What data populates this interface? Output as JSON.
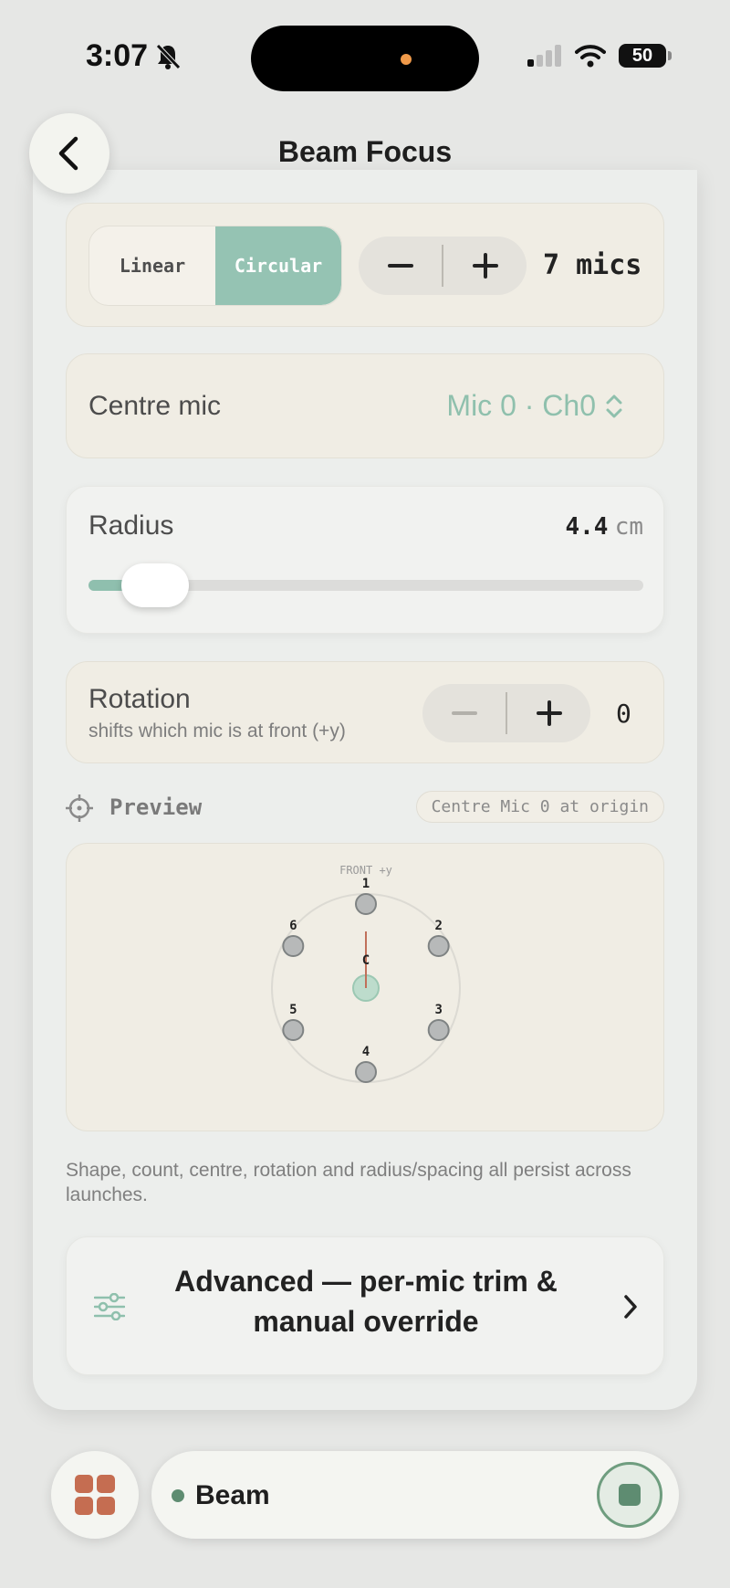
{
  "status": {
    "time": "3:07",
    "battery": "50"
  },
  "header": {
    "title": "Beam Focus"
  },
  "layout": {
    "shapes": [
      "Linear",
      "Circular"
    ],
    "selected": "Circular",
    "mic_count_label": "7 mics"
  },
  "centre_mic": {
    "label": "Centre mic",
    "value": "Mic 0 · Ch0"
  },
  "radius": {
    "label": "Radius",
    "value": "4.4",
    "unit": "cm",
    "slider_fraction": 0.12
  },
  "rotation": {
    "label": "Rotation",
    "hint": "shifts which mic is at front (+y)",
    "value": "0"
  },
  "preview": {
    "title": "Preview",
    "badge": "Centre Mic 0 at origin",
    "front_label": "FRONT +y",
    "centre_label": "C",
    "mics": [
      "1",
      "2",
      "3",
      "4",
      "5",
      "6"
    ]
  },
  "note": "Shape, count, centre, rotation and radius/spacing all persist across launches.",
  "advanced": {
    "label": "Advanced — per-mic trim & manual override"
  },
  "tab": {
    "label": "Beam"
  },
  "colors": {
    "accent": "#95c3b3",
    "card": "#f0ede4",
    "mic_fill": "#b7b9b9",
    "centre_fill": "#bddccc",
    "direction": "#c0705a"
  }
}
